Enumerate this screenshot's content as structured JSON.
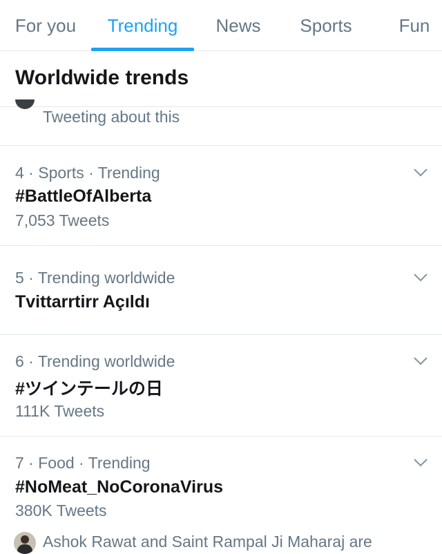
{
  "tabs": [
    {
      "label": "For you",
      "active": false
    },
    {
      "label": "Trending",
      "active": true
    },
    {
      "label": "News",
      "active": false
    },
    {
      "label": "Sports",
      "active": false
    },
    {
      "label": "Fun",
      "active": false
    }
  ],
  "section_title": "Worldwide trends",
  "prev_item_context": "Tweeting about this",
  "trends": [
    {
      "meta": "4 · Sports · Trending",
      "name": "#BattleOfAlberta",
      "count": "7,053 Tweets"
    },
    {
      "meta": "5 · Trending worldwide",
      "name": "Tvittarrtirr Açıldı",
      "count": ""
    },
    {
      "meta": "6 · Trending worldwide",
      "name": "#ツインテールの日",
      "count": "111K Tweets"
    },
    {
      "meta": "7 · Food · Trending",
      "name": "#NoMeat_NoCoronaVirus",
      "count": "380K Tweets",
      "social_context": "Ashok Rawat and Saint Rampal Ji Maharaj are"
    }
  ],
  "colors": {
    "accent": "#1da1f2",
    "secondary_text": "#657786",
    "primary_text": "#14171a",
    "divider": "#e1e8ed"
  },
  "icons": {
    "more": "chevron-down-icon"
  }
}
